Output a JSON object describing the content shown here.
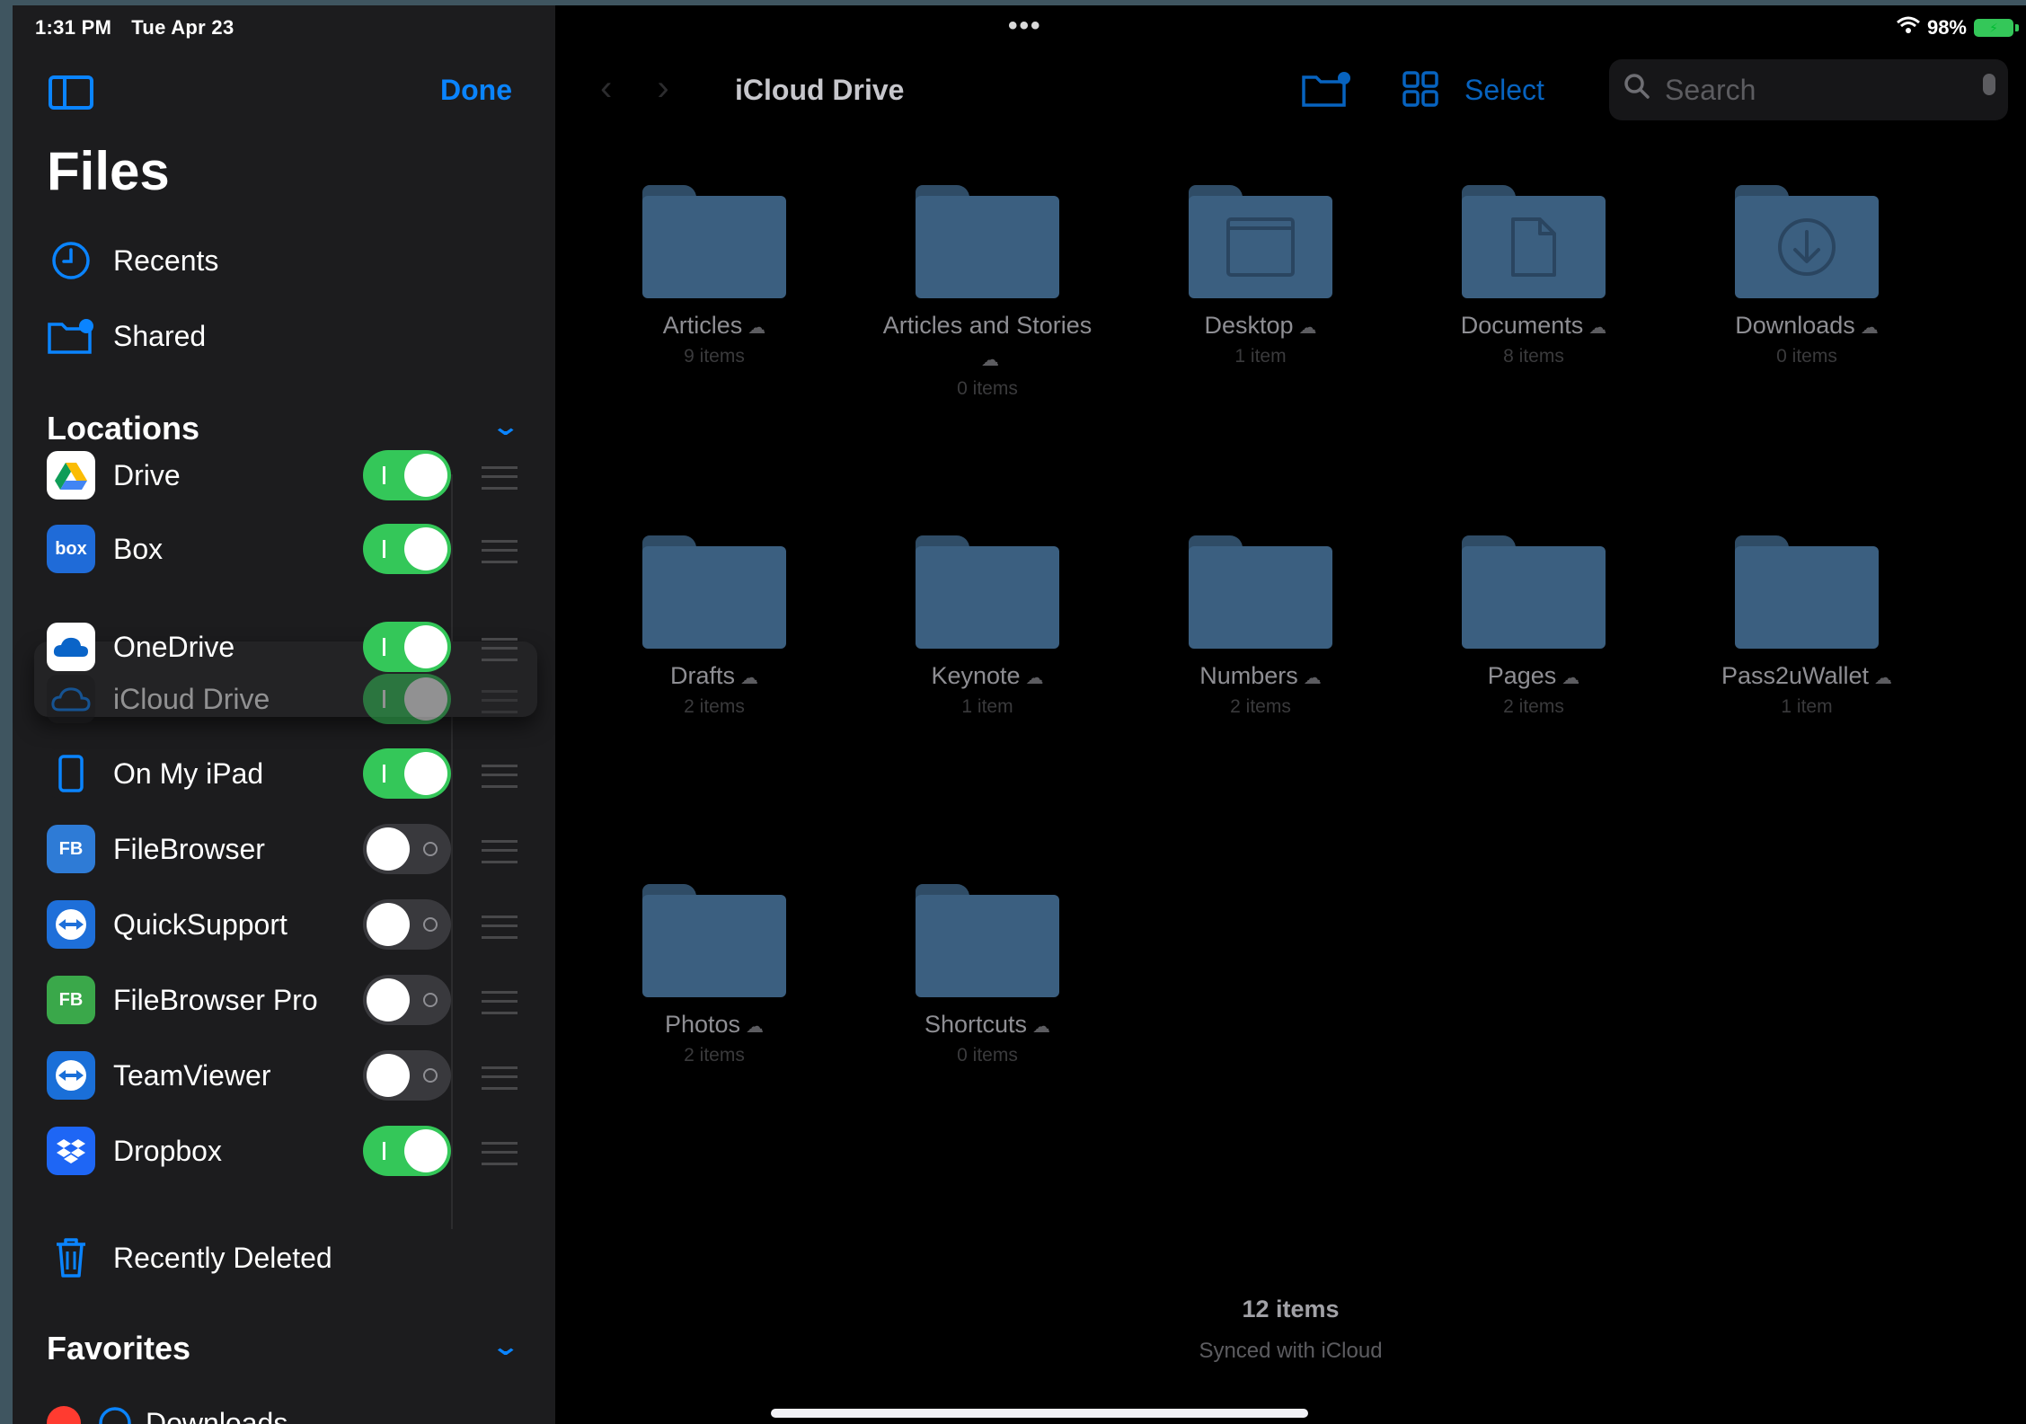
{
  "status": {
    "time": "1:31 PM",
    "date": "Tue Apr 23",
    "dots": "•••",
    "battery_pct": "98%"
  },
  "sidebar": {
    "done_label": "Done",
    "title": "Files",
    "nav": [
      {
        "label": "Recents",
        "icon": "clock-icon"
      },
      {
        "label": "Shared",
        "icon": "shared-folder-icon"
      }
    ],
    "locations_header": "Locations",
    "locations": [
      {
        "label": "Drive",
        "enabled": true,
        "icon": "google-drive-icon",
        "icon_color": "#ffffff"
      },
      {
        "label": "Box",
        "enabled": true,
        "icon": "box-icon",
        "icon_color": "#1f6bd8",
        "icon_text": "box"
      },
      {
        "label": "OneDrive",
        "enabled": true,
        "icon": "onedrive-icon",
        "icon_color": "#ffffff"
      },
      {
        "label": "iCloud Drive",
        "enabled": true,
        "icon": "icloud-icon",
        "icon_color": "#1c1c1e"
      },
      {
        "label": "On My iPad",
        "enabled": true,
        "icon": "ipad-icon",
        "icon_color": "#1c1c1e"
      },
      {
        "label": "FileBrowser",
        "enabled": false,
        "icon": "filebrowser-icon",
        "icon_color": "#2e7bd6",
        "icon_text": "FB"
      },
      {
        "label": "QuickSupport",
        "enabled": false,
        "icon": "quicksupport-icon",
        "icon_color": "#1e6fd9"
      },
      {
        "label": "FileBrowser Pro",
        "enabled": false,
        "icon": "filebrowser-pro-icon",
        "icon_color": "#3aa84a",
        "icon_text": "FB"
      },
      {
        "label": "TeamViewer",
        "enabled": false,
        "icon": "teamviewer-icon",
        "icon_color": "#1a6fd8"
      },
      {
        "label": "Dropbox",
        "enabled": true,
        "icon": "dropbox-icon",
        "icon_color": "#1e66f5"
      }
    ],
    "recently_deleted": "Recently Deleted",
    "favorites_header": "Favorites",
    "favorites_partial": "Downloads"
  },
  "main": {
    "title": "iCloud Drive",
    "select_label": "Select",
    "search_placeholder": "Search",
    "folders": [
      {
        "name": "Articles",
        "count": "9 items",
        "glyph": ""
      },
      {
        "name": "Articles and Stories",
        "count": "0 items",
        "glyph": ""
      },
      {
        "name": "Desktop",
        "count": "1 item",
        "glyph": "window"
      },
      {
        "name": "Documents",
        "count": "8 items",
        "glyph": "doc"
      },
      {
        "name": "Downloads",
        "count": "0 items",
        "glyph": "download"
      },
      {
        "name": "Drafts",
        "count": "2 items",
        "glyph": ""
      },
      {
        "name": "Keynote",
        "count": "1 item",
        "glyph": ""
      },
      {
        "name": "Numbers",
        "count": "2 items",
        "glyph": ""
      },
      {
        "name": "Pages",
        "count": "2 items",
        "glyph": ""
      },
      {
        "name": "Pass2uWallet",
        "count": "1 item",
        "glyph": ""
      },
      {
        "name": "Photos",
        "count": "2 items",
        "glyph": ""
      },
      {
        "name": "Shortcuts",
        "count": "0 items",
        "glyph": ""
      }
    ],
    "footer_count": "12 items",
    "footer_sync": "Synced with iCloud"
  },
  "colors": {
    "accent": "#0a84ff",
    "toggle_on": "#34c759",
    "folder": "#3b5f80",
    "sidebar_bg": "#1c1c1e"
  }
}
